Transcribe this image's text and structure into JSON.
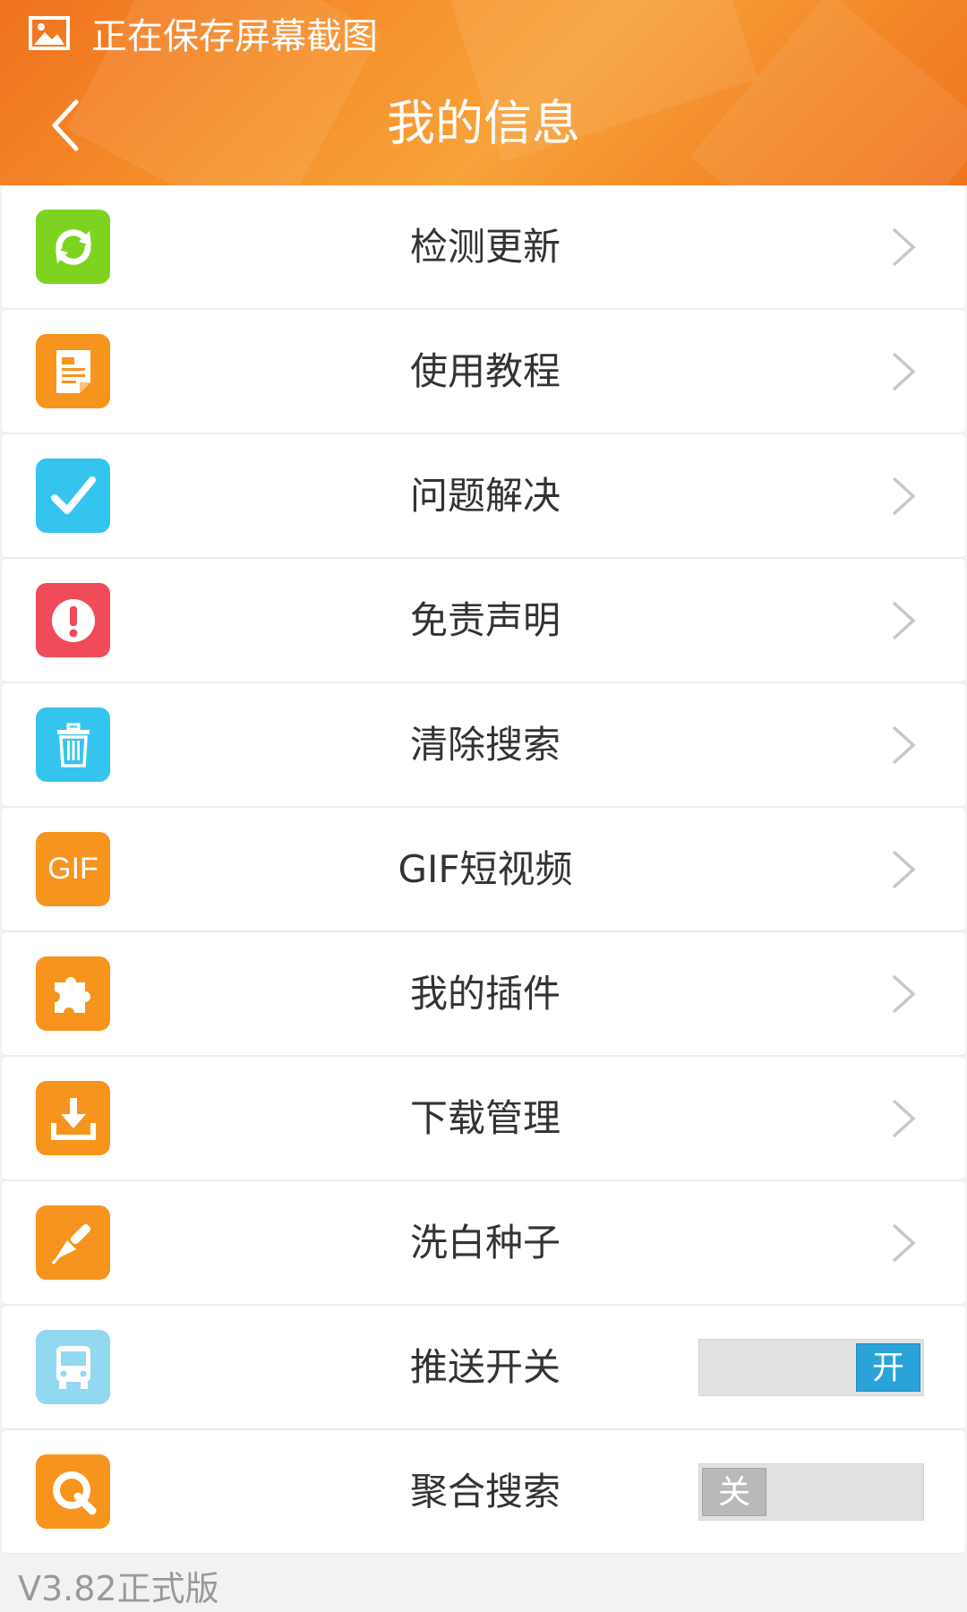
{
  "status_bar": {
    "text": "正在保存屏幕截图",
    "icon": "image-icon"
  },
  "header": {
    "title": "我的信息",
    "back_icon": "chevron-left-icon",
    "color": "#f38626"
  },
  "menu": [
    {
      "label": "检测更新",
      "icon": "refresh-icon",
      "color": "#7ed321",
      "type": "nav"
    },
    {
      "label": "使用教程",
      "icon": "document-icon",
      "color": "#f7941d",
      "type": "nav"
    },
    {
      "label": "问题解决",
      "icon": "check-icon",
      "color": "#35c4ee",
      "type": "nav"
    },
    {
      "label": "免责声明",
      "icon": "alert-icon",
      "color": "#ef4b59",
      "type": "nav"
    },
    {
      "label": "清除搜索",
      "icon": "trash-icon",
      "color": "#35c4ee",
      "type": "nav"
    },
    {
      "label": "GIF短视频",
      "icon": "gif-icon",
      "icon_text": "GIF",
      "color": "#f7941d",
      "type": "nav"
    },
    {
      "label": "我的插件",
      "icon": "puzzle-icon",
      "color": "#f7941d",
      "type": "nav"
    },
    {
      "label": "下载管理",
      "icon": "download-icon",
      "color": "#f7941d",
      "type": "nav"
    },
    {
      "label": "洗白种子",
      "icon": "brush-icon",
      "color": "#f7941d",
      "type": "nav"
    },
    {
      "label": "推送开关",
      "icon": "bus-icon",
      "color": "#92d8ef",
      "type": "toggle",
      "state": "on",
      "toggle_text": "开",
      "toggle_color": "#2aa3d9"
    },
    {
      "label": "聚合搜索",
      "icon": "search-q-icon",
      "color": "#f7941d",
      "type": "toggle",
      "state": "off",
      "toggle_text": "关",
      "toggle_color": "#b9b9b9"
    }
  ],
  "footer": {
    "version": "V3.82正式版"
  }
}
